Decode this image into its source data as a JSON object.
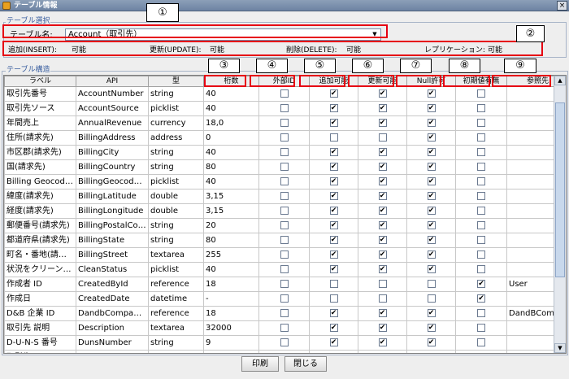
{
  "window": {
    "title": "テーブル情報",
    "close_glyph": "×"
  },
  "selection": {
    "legend": "テーブル選択",
    "table_label": "テーブル名:",
    "table_value": "Account（取引先）",
    "permissions": [
      {
        "label": "追加(INSERT):",
        "value": "可能"
      },
      {
        "label": "更新(UPDATE):",
        "value": "可能"
      },
      {
        "label": "削除(DELETE):",
        "value": "可能"
      },
      {
        "label": "レプリケーション:",
        "value": "可能"
      }
    ]
  },
  "structure": {
    "legend": "テーブル構造",
    "columns": [
      "ラベル",
      "API",
      "型",
      "桁数",
      "外部ID",
      "追加可能",
      "更新可能",
      "Null許可",
      "初期値有無",
      "参照先"
    ],
    "rows": [
      [
        "取引先番号",
        "AccountNumber",
        "string",
        "40",
        false,
        true,
        true,
        true,
        false,
        ""
      ],
      [
        "取引先ソース",
        "AccountSource",
        "picklist",
        "40",
        false,
        true,
        true,
        true,
        false,
        ""
      ],
      [
        "年間売上",
        "AnnualRevenue",
        "currency",
        "18,0",
        false,
        true,
        true,
        true,
        false,
        ""
      ],
      [
        "住所(請求先)",
        "BillingAddress",
        "address",
        "0",
        false,
        false,
        false,
        true,
        false,
        ""
      ],
      [
        "市区郡(請求先)",
        "BillingCity",
        "string",
        "40",
        false,
        true,
        true,
        true,
        false,
        ""
      ],
      [
        "国(請求先)",
        "BillingCountry",
        "string",
        "80",
        false,
        true,
        true,
        true,
        false,
        ""
      ],
      [
        "Billing Geocode ...",
        "BillingGeocodeAc...",
        "picklist",
        "40",
        false,
        true,
        true,
        true,
        false,
        ""
      ],
      [
        "緯度(請求先)",
        "BillingLatitude",
        "double",
        "3,15",
        false,
        true,
        true,
        true,
        false,
        ""
      ],
      [
        "経度(請求先)",
        "BillingLongitude",
        "double",
        "3,15",
        false,
        true,
        true,
        true,
        false,
        ""
      ],
      [
        "郵便番号(請求先)",
        "BillingPostalCode",
        "string",
        "20",
        false,
        true,
        true,
        true,
        false,
        ""
      ],
      [
        "都道府県(請求先)",
        "BillingState",
        "string",
        "80",
        false,
        true,
        true,
        true,
        false,
        ""
      ],
      [
        "町名・番地(請求先)",
        "BillingStreet",
        "textarea",
        "255",
        false,
        true,
        true,
        true,
        false,
        ""
      ],
      [
        "状況をクリーンア...",
        "CleanStatus",
        "picklist",
        "40",
        false,
        true,
        true,
        true,
        false,
        ""
      ],
      [
        "作成者 ID",
        "CreatedById",
        "reference",
        "18",
        false,
        false,
        false,
        false,
        true,
        "User"
      ],
      [
        "作成日",
        "CreatedDate",
        "datetime",
        "-",
        false,
        false,
        false,
        false,
        true,
        ""
      ],
      [
        "D&B 企業 ID",
        "DandbCompanyId",
        "reference",
        "18",
        false,
        true,
        true,
        true,
        false,
        "DandBCompany"
      ],
      [
        "取引先 説明",
        "Description",
        "textarea",
        "32000",
        false,
        true,
        true,
        true,
        false,
        ""
      ],
      [
        "D-U-N-S 番号",
        "DunsNumber",
        "string",
        "9",
        false,
        true,
        true,
        true,
        false,
        ""
      ],
      [
        "取引先 Fax",
        "Fax",
        "phone",
        "40",
        false,
        true,
        true,
        true,
        false,
        ""
      ],
      [
        "取引先 ID",
        "Id",
        "id",
        "18",
        false,
        false,
        false,
        false,
        true,
        ""
      ],
      [
        "業種",
        "Industry",
        "picklist",
        "40",
        false,
        true,
        true,
        true,
        false,
        ""
      ]
    ]
  },
  "annotations": {
    "markers": [
      "①",
      "②",
      "③",
      "④",
      "⑤",
      "⑥",
      "⑦",
      "⑧",
      "⑨"
    ],
    "color": "#e60012"
  },
  "buttons": {
    "print": "印刷",
    "close": "閉じる"
  },
  "icons": [
    "app-icon",
    "close-icon",
    "dropdown-arrow-icon",
    "scroll-up-icon",
    "scroll-down-icon"
  ]
}
